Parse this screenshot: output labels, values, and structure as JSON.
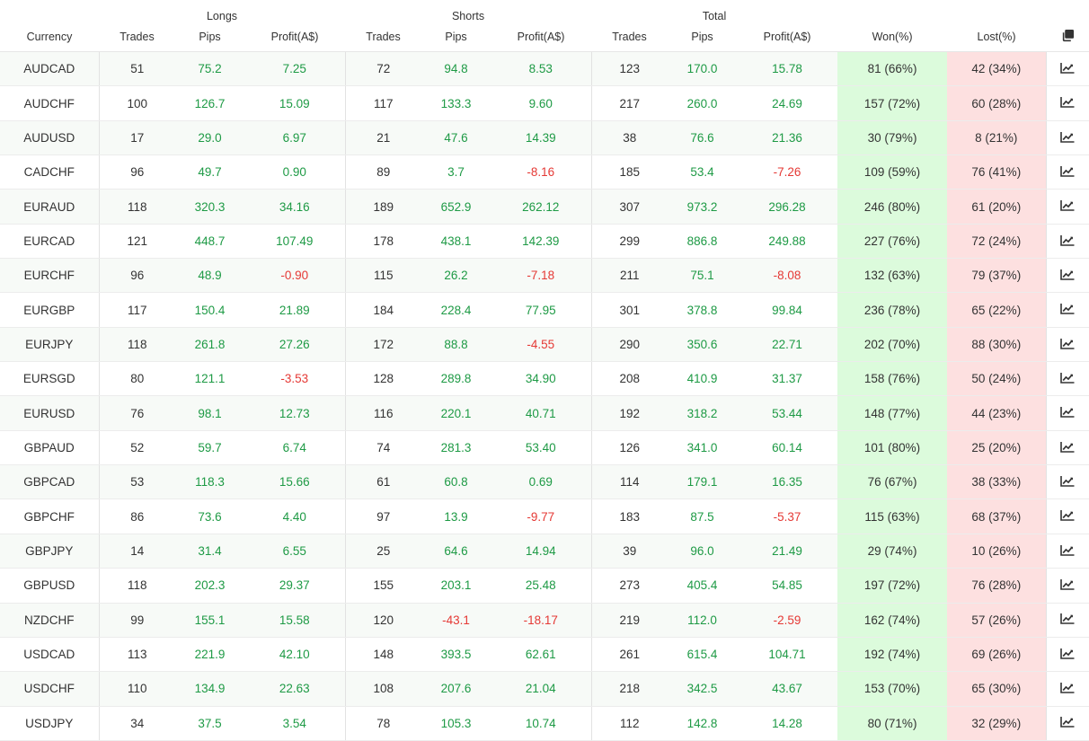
{
  "groups": {
    "longs": "Longs",
    "shorts": "Shorts",
    "total": "Total"
  },
  "columns": {
    "currency": "Currency",
    "long_trades": "Trades",
    "long_pips": "Pips",
    "long_profit": "Profit(A$)",
    "short_trades": "Trades",
    "short_pips": "Pips",
    "short_profit": "Profit(A$)",
    "total_trades": "Trades",
    "total_pips": "Pips",
    "total_profit": "Profit(A$)",
    "won": "Won(%)",
    "lost": "Lost(%)"
  },
  "colors": {
    "positive": "#1e9a45",
    "negative": "#e53935",
    "won_bg": "#dcfbdc",
    "lost_bg": "#fde0e0"
  },
  "icons": {
    "header": "copy-icon",
    "row": "chart-line-icon"
  },
  "rows": [
    {
      "currency": "AUDCAD",
      "long_trades": "51",
      "long_pips": "75.2",
      "long_profit": "7.25",
      "short_trades": "72",
      "short_pips": "94.8",
      "short_profit": "8.53",
      "total_trades": "123",
      "total_pips": "170.0",
      "total_profit": "15.78",
      "won": "81 (66%)",
      "lost": "42 (34%)"
    },
    {
      "currency": "AUDCHF",
      "long_trades": "100",
      "long_pips": "126.7",
      "long_profit": "15.09",
      "short_trades": "117",
      "short_pips": "133.3",
      "short_profit": "9.60",
      "total_trades": "217",
      "total_pips": "260.0",
      "total_profit": "24.69",
      "won": "157 (72%)",
      "lost": "60 (28%)"
    },
    {
      "currency": "AUDUSD",
      "long_trades": "17",
      "long_pips": "29.0",
      "long_profit": "6.97",
      "short_trades": "21",
      "short_pips": "47.6",
      "short_profit": "14.39",
      "total_trades": "38",
      "total_pips": "76.6",
      "total_profit": "21.36",
      "won": "30 (79%)",
      "lost": "8 (21%)"
    },
    {
      "currency": "CADCHF",
      "long_trades": "96",
      "long_pips": "49.7",
      "long_profit": "0.90",
      "short_trades": "89",
      "short_pips": "3.7",
      "short_profit": "-8.16",
      "total_trades": "185",
      "total_pips": "53.4",
      "total_profit": "-7.26",
      "won": "109 (59%)",
      "lost": "76 (41%)"
    },
    {
      "currency": "EURAUD",
      "long_trades": "118",
      "long_pips": "320.3",
      "long_profit": "34.16",
      "short_trades": "189",
      "short_pips": "652.9",
      "short_profit": "262.12",
      "total_trades": "307",
      "total_pips": "973.2",
      "total_profit": "296.28",
      "won": "246 (80%)",
      "lost": "61 (20%)"
    },
    {
      "currency": "EURCAD",
      "long_trades": "121",
      "long_pips": "448.7",
      "long_profit": "107.49",
      "short_trades": "178",
      "short_pips": "438.1",
      "short_profit": "142.39",
      "total_trades": "299",
      "total_pips": "886.8",
      "total_profit": "249.88",
      "won": "227 (76%)",
      "lost": "72 (24%)"
    },
    {
      "currency": "EURCHF",
      "long_trades": "96",
      "long_pips": "48.9",
      "long_profit": "-0.90",
      "short_trades": "115",
      "short_pips": "26.2",
      "short_profit": "-7.18",
      "total_trades": "211",
      "total_pips": "75.1",
      "total_profit": "-8.08",
      "won": "132 (63%)",
      "lost": "79 (37%)"
    },
    {
      "currency": "EURGBP",
      "long_trades": "117",
      "long_pips": "150.4",
      "long_profit": "21.89",
      "short_trades": "184",
      "short_pips": "228.4",
      "short_profit": "77.95",
      "total_trades": "301",
      "total_pips": "378.8",
      "total_profit": "99.84",
      "won": "236 (78%)",
      "lost": "65 (22%)"
    },
    {
      "currency": "EURJPY",
      "long_trades": "118",
      "long_pips": "261.8",
      "long_profit": "27.26",
      "short_trades": "172",
      "short_pips": "88.8",
      "short_profit": "-4.55",
      "total_trades": "290",
      "total_pips": "350.6",
      "total_profit": "22.71",
      "won": "202 (70%)",
      "lost": "88 (30%)"
    },
    {
      "currency": "EURSGD",
      "long_trades": "80",
      "long_pips": "121.1",
      "long_profit": "-3.53",
      "short_trades": "128",
      "short_pips": "289.8",
      "short_profit": "34.90",
      "total_trades": "208",
      "total_pips": "410.9",
      "total_profit": "31.37",
      "won": "158 (76%)",
      "lost": "50 (24%)"
    },
    {
      "currency": "EURUSD",
      "long_trades": "76",
      "long_pips": "98.1",
      "long_profit": "12.73",
      "short_trades": "116",
      "short_pips": "220.1",
      "short_profit": "40.71",
      "total_trades": "192",
      "total_pips": "318.2",
      "total_profit": "53.44",
      "won": "148 (77%)",
      "lost": "44 (23%)"
    },
    {
      "currency": "GBPAUD",
      "long_trades": "52",
      "long_pips": "59.7",
      "long_profit": "6.74",
      "short_trades": "74",
      "short_pips": "281.3",
      "short_profit": "53.40",
      "total_trades": "126",
      "total_pips": "341.0",
      "total_profit": "60.14",
      "won": "101 (80%)",
      "lost": "25 (20%)"
    },
    {
      "currency": "GBPCAD",
      "long_trades": "53",
      "long_pips": "118.3",
      "long_profit": "15.66",
      "short_trades": "61",
      "short_pips": "60.8",
      "short_profit": "0.69",
      "total_trades": "114",
      "total_pips": "179.1",
      "total_profit": "16.35",
      "won": "76 (67%)",
      "lost": "38 (33%)"
    },
    {
      "currency": "GBPCHF",
      "long_trades": "86",
      "long_pips": "73.6",
      "long_profit": "4.40",
      "short_trades": "97",
      "short_pips": "13.9",
      "short_profit": "-9.77",
      "total_trades": "183",
      "total_pips": "87.5",
      "total_profit": "-5.37",
      "won": "115 (63%)",
      "lost": "68 (37%)"
    },
    {
      "currency": "GBPJPY",
      "long_trades": "14",
      "long_pips": "31.4",
      "long_profit": "6.55",
      "short_trades": "25",
      "short_pips": "64.6",
      "short_profit": "14.94",
      "total_trades": "39",
      "total_pips": "96.0",
      "total_profit": "21.49",
      "won": "29 (74%)",
      "lost": "10 (26%)"
    },
    {
      "currency": "GBPUSD",
      "long_trades": "118",
      "long_pips": "202.3",
      "long_profit": "29.37",
      "short_trades": "155",
      "short_pips": "203.1",
      "short_profit": "25.48",
      "total_trades": "273",
      "total_pips": "405.4",
      "total_profit": "54.85",
      "won": "197 (72%)",
      "lost": "76 (28%)"
    },
    {
      "currency": "NZDCHF",
      "long_trades": "99",
      "long_pips": "155.1",
      "long_profit": "15.58",
      "short_trades": "120",
      "short_pips": "-43.1",
      "short_profit": "-18.17",
      "total_trades": "219",
      "total_pips": "112.0",
      "total_profit": "-2.59",
      "won": "162 (74%)",
      "lost": "57 (26%)"
    },
    {
      "currency": "USDCAD",
      "long_trades": "113",
      "long_pips": "221.9",
      "long_profit": "42.10",
      "short_trades": "148",
      "short_pips": "393.5",
      "short_profit": "62.61",
      "total_trades": "261",
      "total_pips": "615.4",
      "total_profit": "104.71",
      "won": "192 (74%)",
      "lost": "69 (26%)"
    },
    {
      "currency": "USDCHF",
      "long_trades": "110",
      "long_pips": "134.9",
      "long_profit": "22.63",
      "short_trades": "108",
      "short_pips": "207.6",
      "short_profit": "21.04",
      "total_trades": "218",
      "total_pips": "342.5",
      "total_profit": "43.67",
      "won": "153 (70%)",
      "lost": "65 (30%)"
    },
    {
      "currency": "USDJPY",
      "long_trades": "34",
      "long_pips": "37.5",
      "long_profit": "3.54",
      "short_trades": "78",
      "short_pips": "105.3",
      "short_profit": "10.74",
      "total_trades": "112",
      "total_pips": "142.8",
      "total_profit": "14.28",
      "won": "80 (71%)",
      "lost": "32 (29%)"
    }
  ]
}
